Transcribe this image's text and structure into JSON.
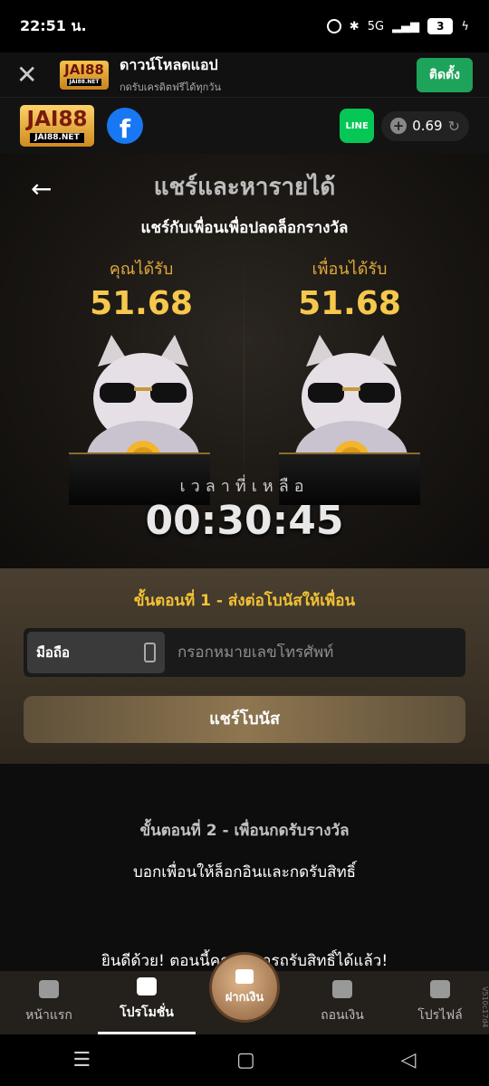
{
  "status_bar": {
    "time": "22:51 น.",
    "network": "5G",
    "battery": "3"
  },
  "banner": {
    "logo_text": "JAI88",
    "logo_sub": "JAI88.NET",
    "title": "ดาวน์โหลดแอป",
    "subtitle": "กดรับเครดิตฟรีได้ทุกวัน",
    "install_label": "ติดตั้ง"
  },
  "header": {
    "logo_text": "JAI88",
    "logo_sub": "JAI88.NET",
    "facebook": "f",
    "line": "LINE",
    "balance": "0.69"
  },
  "hero": {
    "title": "แชร์และหารายได้",
    "subtitle": "แชร์กับเพื่อนเพื่อปลดล็อกรางวัล",
    "you_label": "คุณได้รับ",
    "you_amount": "51.68",
    "friend_label": "เพื่อนได้รับ",
    "friend_amount": "51.68",
    "timer_label": "เวลาที่เหลือ",
    "timer": "00:30:45"
  },
  "step1": {
    "title": "ขั้นตอนที่ 1 - ส่งต่อโบนัสให้เพื่อน",
    "phone_tag": "มือถือ",
    "phone_placeholder": "กรอกหมายเลขโทรศัพท์",
    "share_label": "แชร์โบนัส"
  },
  "step2": {
    "title": "ขั้นตอนที่ 2 - เพื่อนกดรับรางวัล",
    "text": "บอกเพื่อนให้ล็อกอินและกดรับสิทธิ์",
    "congrats": "ยินดีด้วย! ตอนนี้คุณสามารถรับสิทธิ์ได้แล้ว!"
  },
  "nav": {
    "home": "หน้าแรก",
    "promo": "โปรโมชั่น",
    "deposit": "ฝากเงิน",
    "withdraw": "ถอนเงิน",
    "profile": "โปรไฟล์"
  },
  "side_tag": "V510c17d4"
}
